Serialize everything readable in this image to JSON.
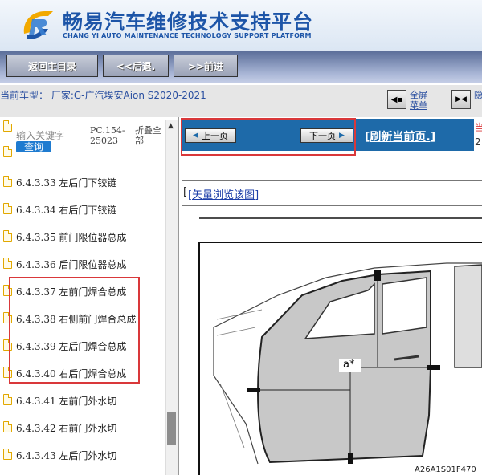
{
  "header": {
    "brand_cn": "畅易汽车维修技术支持平台",
    "brand_en": "CHANG YI AUTO MAINTENANCE TECHNOLOGY SUPPORT PLATFORM"
  },
  "nav": {
    "home": "返回主目录",
    "back": "<<后退.",
    "forward": ">>前进"
  },
  "vehicle": {
    "label": "当前车型： 厂家:G-广汽埃安Aion S2020-2021",
    "fullscreen": [
      "全屏",
      "菜单"
    ],
    "next_label": "隐"
  },
  "search": {
    "placeholder": "输入关键字",
    "query_button": "查询",
    "code": [
      "PC.154-",
      "25023"
    ],
    "collapse": [
      "折叠全",
      "部"
    ]
  },
  "tree_items": [
    "6.4.3.33 左后门下铰链",
    "6.4.3.34 右后门下铰链",
    "6.4.3.35 前门限位器总成",
    "6.4.3.36 后门限位器总成",
    "6.4.3.37 左前门焊合总成",
    "6.4.3.38 右侧前门焊合总成",
    "6.4.3.39 左后门焊合总成",
    "6.4.3.40 右后门焊合总成",
    "6.4.3.41 左前门外水切",
    "6.4.3.42 右前门外水切",
    "6.4.3.43 左后门外水切"
  ],
  "pager": {
    "prev": "上一页",
    "next": "下一页",
    "refresh": "[刷新当前页.]",
    "edge_top": "当",
    "edge_bottom": "2"
  },
  "content": {
    "vector_link": "[矢量浏览该图]",
    "bracket": "[",
    "callout": "a*",
    "figure_code": "A26A1S01F470"
  },
  "colors": {
    "brand_blue": "#1d55a8",
    "pager_blue": "#1e6aa9",
    "highlight_red": "#d9383a"
  }
}
